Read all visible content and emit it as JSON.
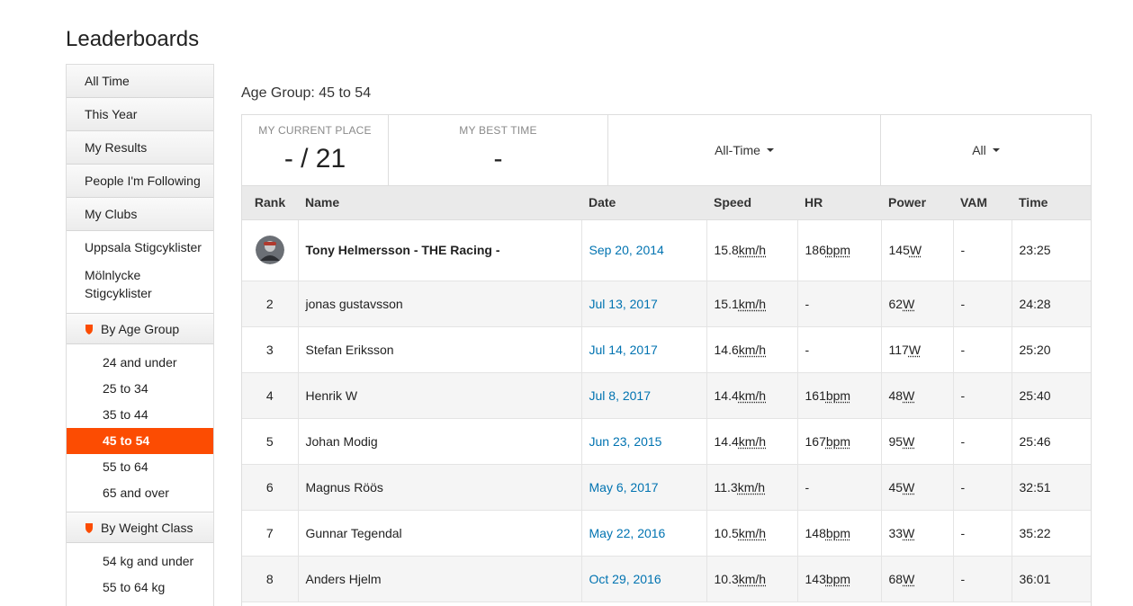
{
  "page": {
    "title": "Leaderboards"
  },
  "sidebar": {
    "tabs": [
      {
        "label": "All Time"
      },
      {
        "label": "This Year"
      },
      {
        "label": "My Results"
      },
      {
        "label": "People I'm Following"
      },
      {
        "label": "My Clubs"
      }
    ],
    "clubs": [
      {
        "label": "Uppsala Stigcyklister"
      },
      {
        "label": "Mölnlycke Stigcyklister"
      }
    ],
    "age_group": {
      "header": "By Age Group",
      "items": [
        {
          "label": "24 and under"
        },
        {
          "label": "25 to 34"
        },
        {
          "label": "35 to 44"
        },
        {
          "label": "45 to 54",
          "active": true
        },
        {
          "label": "55 to 64"
        },
        {
          "label": "65 and over"
        }
      ]
    },
    "weight_class": {
      "header": "By Weight Class",
      "items": [
        {
          "label": "54 kg and under"
        },
        {
          "label": "55 to 64 kg"
        }
      ]
    }
  },
  "main": {
    "group_title": "Age Group: 45 to 54",
    "summary": {
      "current_place_label": "MY CURRENT PLACE",
      "current_place_value": "- / 21",
      "best_time_label": "MY BEST TIME",
      "best_time_value": "-",
      "time_filter": "All-Time",
      "scope_filter": "All"
    },
    "columns": [
      "Rank",
      "Name",
      "Date",
      "Speed",
      "HR",
      "Power",
      "VAM",
      "Time"
    ],
    "rows": [
      {
        "rank": "",
        "name": "Tony Helmersson - THE Racing -",
        "date": "Sep 20, 2014",
        "speed": "15.8",
        "hr": "186",
        "power": "145",
        "vam": "-",
        "time": "23:25"
      },
      {
        "rank": "2",
        "name": "jonas gustavsson",
        "date": "Jul 13, 2017",
        "speed": "15.1",
        "hr": "-",
        "power": "62",
        "vam": "-",
        "time": "24:28"
      },
      {
        "rank": "3",
        "name": "Stefan Eriksson",
        "date": "Jul 14, 2017",
        "speed": "14.6",
        "hr": "-",
        "power": "117",
        "vam": "-",
        "time": "25:20"
      },
      {
        "rank": "4",
        "name": "Henrik W",
        "date": "Jul 8, 2017",
        "speed": "14.4",
        "hr": "161",
        "power": "48",
        "vam": "-",
        "time": "25:40"
      },
      {
        "rank": "5",
        "name": "Johan Modig",
        "date": "Jun 23, 2015",
        "speed": "14.4",
        "hr": "167",
        "power": "95",
        "vam": "-",
        "time": "25:46"
      },
      {
        "rank": "6",
        "name": "Magnus Röös",
        "date": "May 6, 2017",
        "speed": "11.3",
        "hr": "-",
        "power": "45",
        "vam": "-",
        "time": "32:51"
      },
      {
        "rank": "7",
        "name": "Gunnar Tegendal",
        "date": "May 22, 2016",
        "speed": "10.5",
        "hr": "148",
        "power": "33",
        "vam": "-",
        "time": "35:22"
      },
      {
        "rank": "8",
        "name": "Anders Hjelm",
        "date": "Oct 29, 2016",
        "speed": "10.3",
        "hr": "143",
        "power": "68",
        "vam": "-",
        "time": "36:01"
      }
    ],
    "units": {
      "speed": "km/h",
      "hr": "bpm",
      "power": "W"
    }
  },
  "colors": {
    "accent": "#fc4c02",
    "link": "#0073b1"
  }
}
